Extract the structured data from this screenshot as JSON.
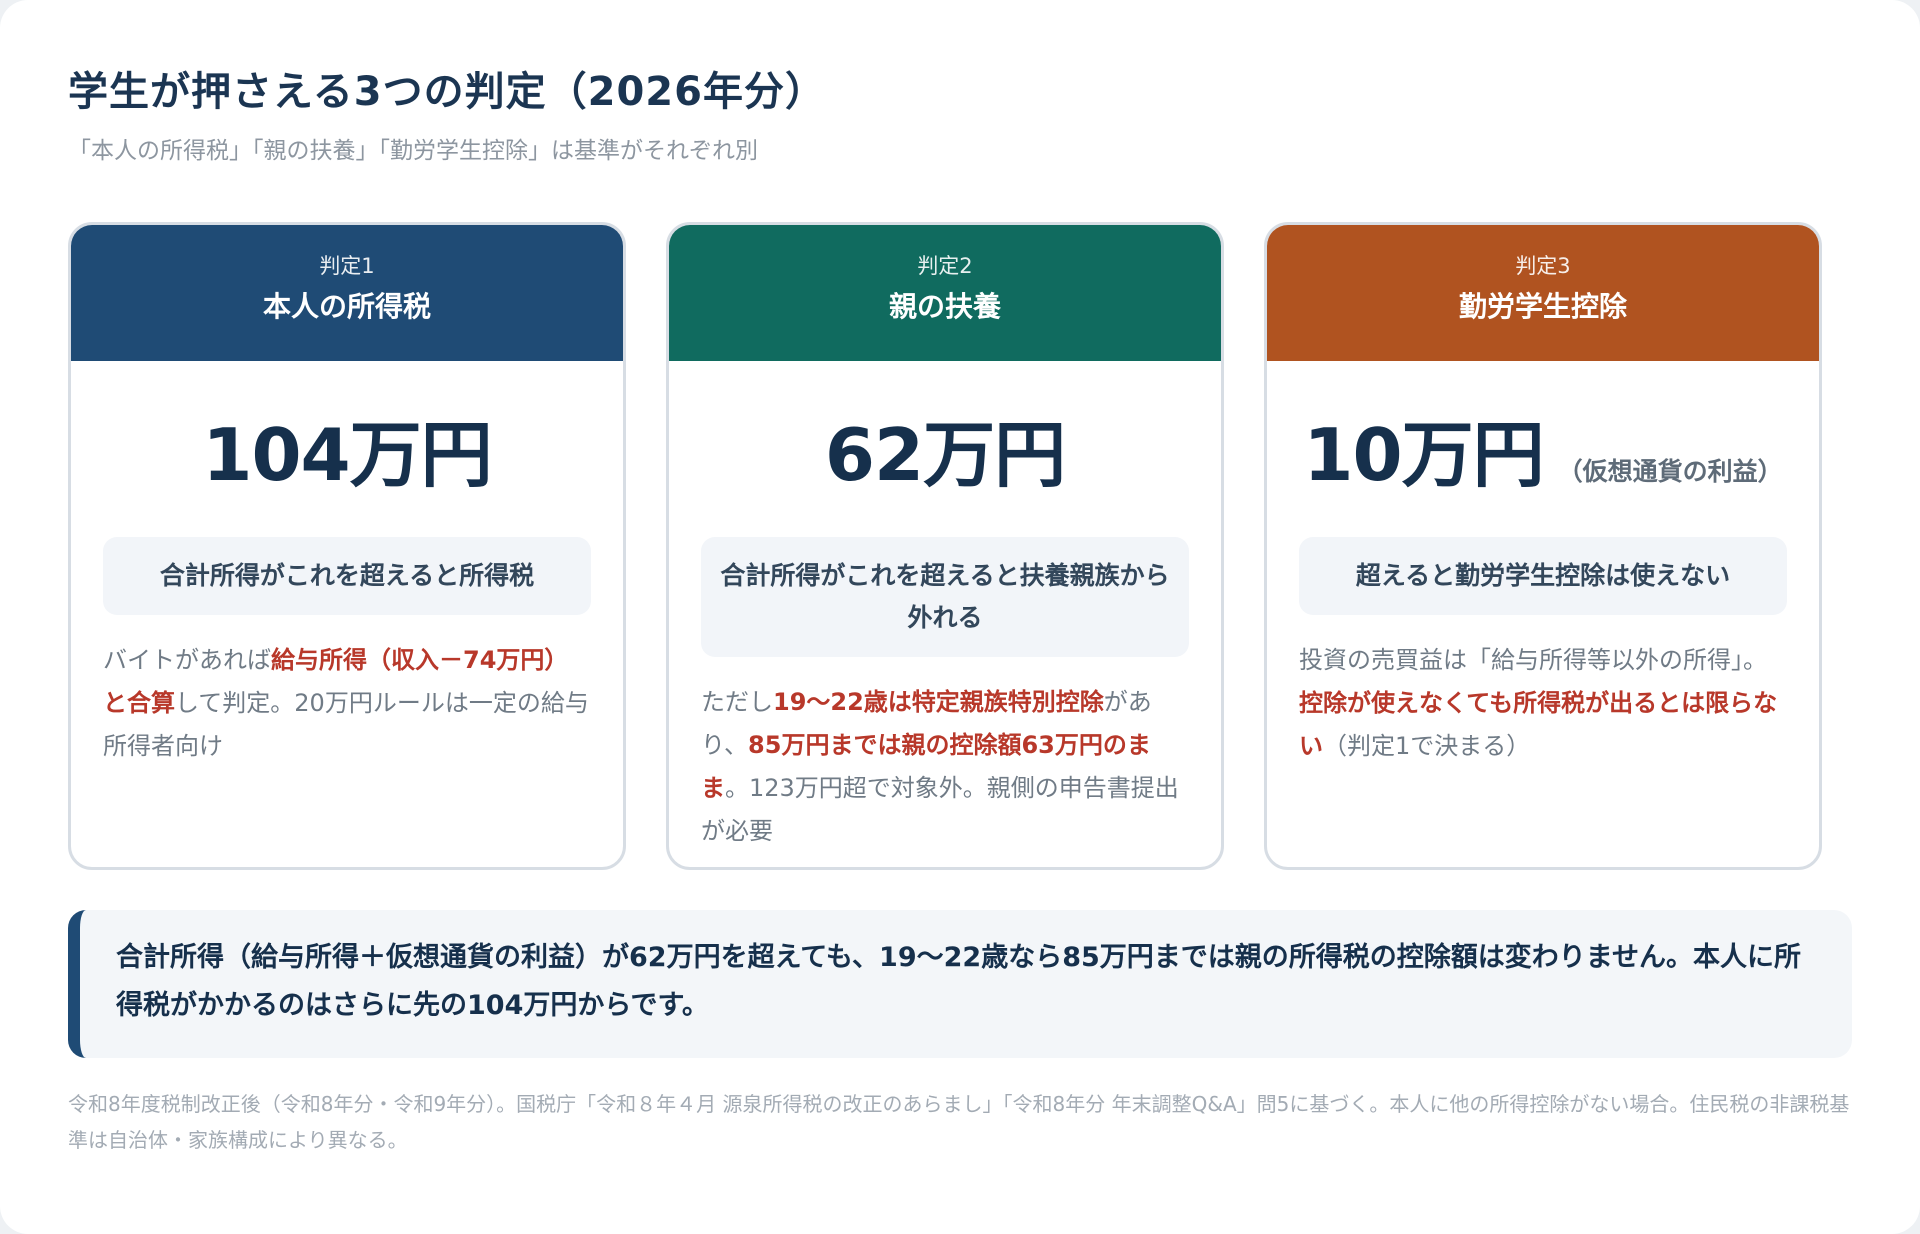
{
  "header": {
    "title": "学生が押さえる3つの判定（2026年分）",
    "subtitle": "「本人の所得税」「親の扶養」「勤労学生控除」は基準がそれぞれ別"
  },
  "cards": [
    {
      "label": "判定1",
      "title": "本人の所得税",
      "amount": "104万円",
      "amount_note": "",
      "condition": "合計所得がこれを超えると所得税",
      "desc": {
        "t1": "バイトがあれば",
        "h1": "給与所得（収入－74万円）と合算",
        "t2": "して判定。20万円ルールは一定の給与所得者向け"
      }
    },
    {
      "label": "判定2",
      "title": "親の扶養",
      "amount": "62万円",
      "amount_note": "",
      "condition": "合計所得がこれを超えると扶養親族から外れる",
      "desc": {
        "t1": "ただし",
        "h1": "19〜22歳は特定親族特別控除",
        "t2": "があり、",
        "h2": "85万円までは親の控除額63万円のまま",
        "t3": "。123万円超で対象外。親側の申告書提出が必要"
      }
    },
    {
      "label": "判定3",
      "title": "勤労学生控除",
      "amount": "10万円",
      "amount_note": "（仮想通貨の利益）",
      "condition": "超えると勤労学生控除は使えない",
      "desc": {
        "t1": "投資の売買益は「給与所得等以外の所得」。",
        "h1": "控除が使えなくても所得税が出るとは限らない",
        "t2": "（判定1で決まる）"
      }
    }
  ],
  "summary": "合計所得（給与所得＋仮想通貨の利益）が62万円を超えても、19〜22歳なら85万円までは親の所得税の控除額は変わりません。本人に所得税がかかるのはさらに先の104万円からです。",
  "footnote": "令和8年度税制改正後（令和8年分・令和9年分）。国税庁「令和８年４月 源泉所得税の改正のあらまし」「令和8年分 年末調整Q&A」問5に基づく。本人に他の所得控除がない場合。住民税の非課税基準は自治体・家族構成により異なる。",
  "colors": {
    "card1_header": "#1f4b75",
    "card2_header": "#106b5f",
    "card3_header": "#b05320",
    "highlight": "#b8382a",
    "title": "#1b3552"
  }
}
